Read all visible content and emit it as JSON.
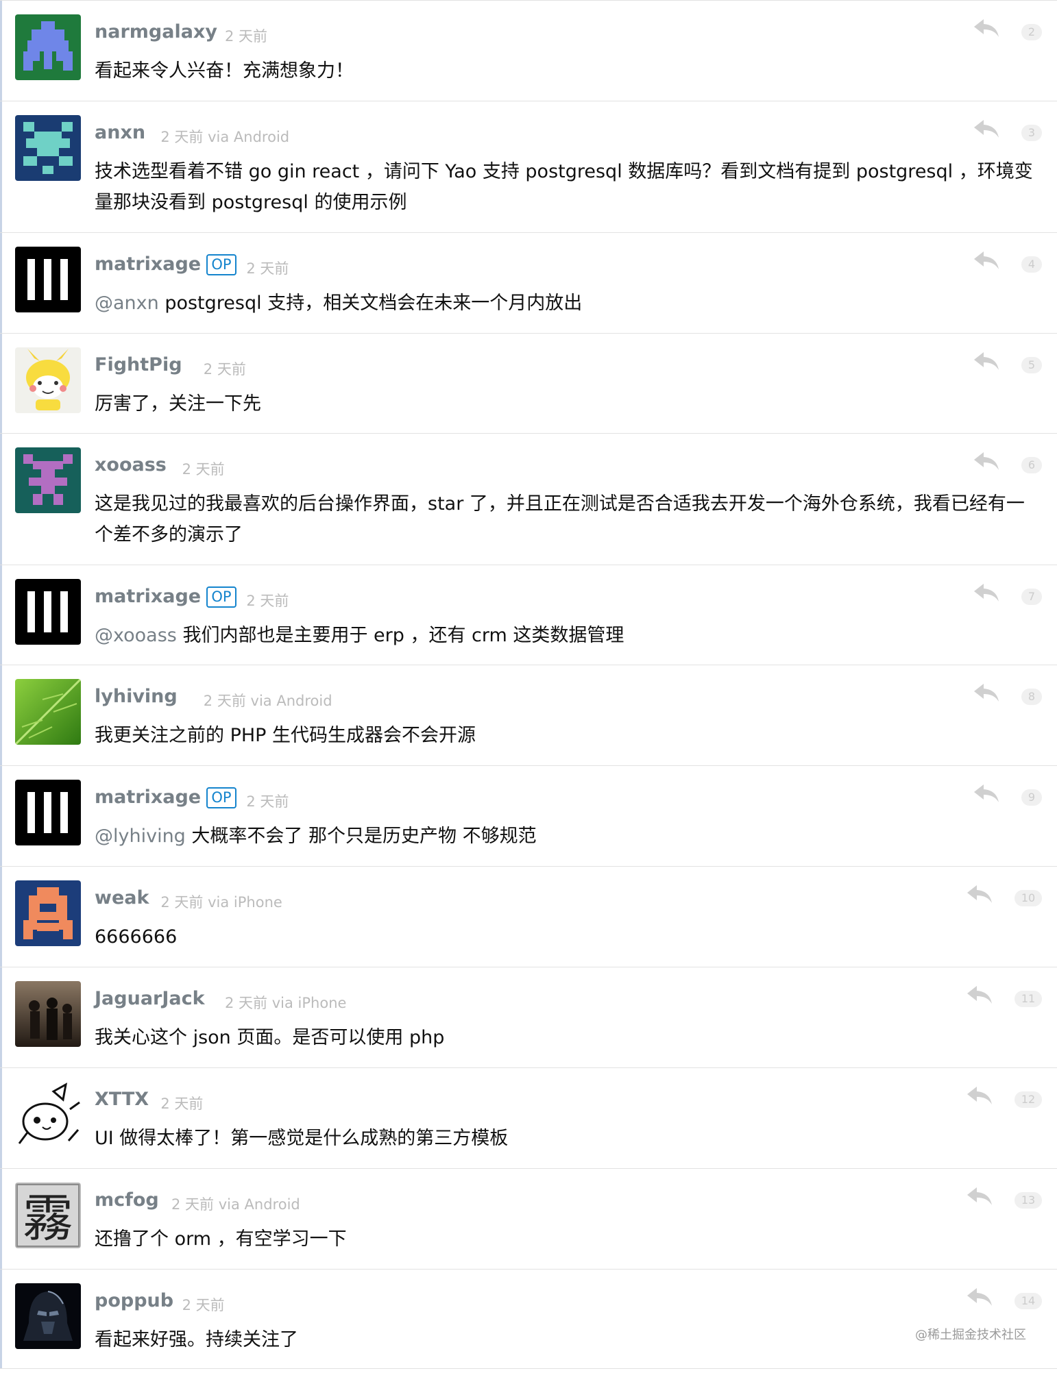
{
  "replies": [
    {
      "id": "r1",
      "username": "narmgalaxy",
      "op": false,
      "time": "2 天前",
      "via": "",
      "avatar": "narmgalaxy-avatar",
      "parts": [
        {
          "t": "看起来令人兴奋！充满想象力！"
        }
      ],
      "no": "2"
    },
    {
      "id": "r2",
      "username": "anxn",
      "op": false,
      "time": "2 天前",
      "via": "via Android",
      "avatar": "anxn-avatar",
      "parts": [
        {
          "t": "技术选型看着不错 go gin react ，请问下 Yao 支持 postgresql 数据库吗？看到文档有提到 postgresql ，环境变量那块没看到 postgresql 的使用示例"
        }
      ],
      "no": "3"
    },
    {
      "id": "r3",
      "username": "matrixage",
      "op": true,
      "time": "2 天前",
      "via": "",
      "avatar": "matrixage-avatar",
      "parts": [
        {
          "t": "@",
          "m": true
        },
        {
          "t": "anxn",
          "m": true
        },
        {
          "t": " postgresql 支持，相关文档会在未来一个月内放出"
        }
      ],
      "no": "4"
    },
    {
      "id": "r4",
      "username": "FightPig",
      "op": false,
      "time": "2 天前",
      "via": "",
      "avatar": "fightpig-avatar",
      "parts": [
        {
          "t": "厉害了，关注一下先"
        }
      ],
      "no": "5"
    },
    {
      "id": "r5",
      "username": "xooass",
      "op": false,
      "time": "2 天前",
      "via": "",
      "avatar": "xooass-avatar",
      "parts": [
        {
          "t": "这是我见过的我最喜欢的后台操作界面，star 了，并且正在测试是否合适我去开发一个海外仓系统，我看已经有一个差不多的演示了"
        }
      ],
      "no": "6"
    },
    {
      "id": "r6",
      "username": "matrixage",
      "op": true,
      "time": "2 天前",
      "via": "",
      "avatar": "matrixage-avatar",
      "parts": [
        {
          "t": "@",
          "m": true
        },
        {
          "t": "xooass",
          "m": true
        },
        {
          "t": " 我们内部也是主要用于 erp ，还有 crm 这类数据管理"
        }
      ],
      "no": "7"
    },
    {
      "id": "r7",
      "username": "lyhiving",
      "op": false,
      "time": "2 天前",
      "via": "via Android",
      "avatar": "lyhiving-avatar",
      "parts": [
        {
          "t": "我更关注之前的 PHP 生代码生成器会不会开源"
        }
      ],
      "no": "8"
    },
    {
      "id": "r8",
      "username": "matrixage",
      "op": true,
      "time": "2 天前",
      "via": "",
      "avatar": "matrixage-avatar",
      "parts": [
        {
          "t": "@",
          "m": true
        },
        {
          "t": "lyhiving",
          "m": true
        },
        {
          "t": " 大概率不会了 那个只是历史产物 不够规范"
        }
      ],
      "no": "9"
    },
    {
      "id": "r9",
      "username": "weak",
      "op": false,
      "time": "2 天前",
      "via": "via iPhone",
      "avatar": "weak-avatar",
      "parts": [
        {
          "t": "6666666"
        }
      ],
      "no": "10"
    },
    {
      "id": "r10",
      "username": "JaguarJack",
      "op": false,
      "time": "2 天前",
      "via": "via iPhone",
      "avatar": "jaguarjack-avatar",
      "parts": [
        {
          "t": "我关心这个 json 页面。是否可以使用 php"
        }
      ],
      "no": "11"
    },
    {
      "id": "r11",
      "username": "XTTX",
      "op": false,
      "time": "2 天前",
      "via": "",
      "avatar": "xttx-avatar",
      "parts": [
        {
          "t": "UI 做得太棒了！第一感觉是什么成熟的第三方模板"
        }
      ],
      "no": "12"
    },
    {
      "id": "r12",
      "username": "mcfog",
      "op": false,
      "time": "2 天前",
      "via": "via Android",
      "avatar": "mcfog-avatar",
      "parts": [
        {
          "t": "还撸了个 orm ，有空学习一下"
        }
      ],
      "no": "13"
    },
    {
      "id": "r13",
      "username": "poppub",
      "op": false,
      "time": "2 天前",
      "via": "",
      "avatar": "poppub-avatar",
      "parts": [
        {
          "t": "看起来好强。持续关注了"
        }
      ],
      "no": "14"
    }
  ],
  "op_label": "OP",
  "avatar_glyphs": {
    "mcfog": "霧"
  },
  "watermark": "@稀土掘金技术社区"
}
